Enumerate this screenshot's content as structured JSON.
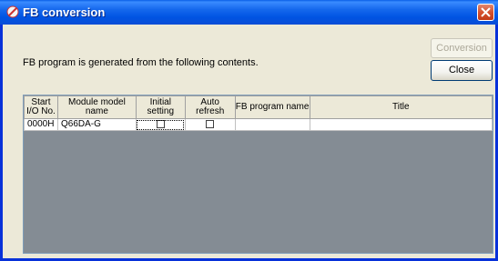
{
  "window": {
    "title": "FB conversion"
  },
  "message": "FB program is generated from the following contents.",
  "buttons": {
    "conversion": "Conversion",
    "close": "Close"
  },
  "grid": {
    "headers": [
      "Start I/O No.",
      "Module model name",
      "Initial setting",
      "Auto refresh",
      "FB program name",
      "Title"
    ],
    "rows": [
      {
        "start_io": "0000H",
        "module": "Q66DA-G",
        "initial_setting": false,
        "auto_refresh": false,
        "fb_program_name": "",
        "title": ""
      }
    ]
  },
  "icons": {
    "app": "fb-conversion-icon",
    "close": "close-icon"
  }
}
